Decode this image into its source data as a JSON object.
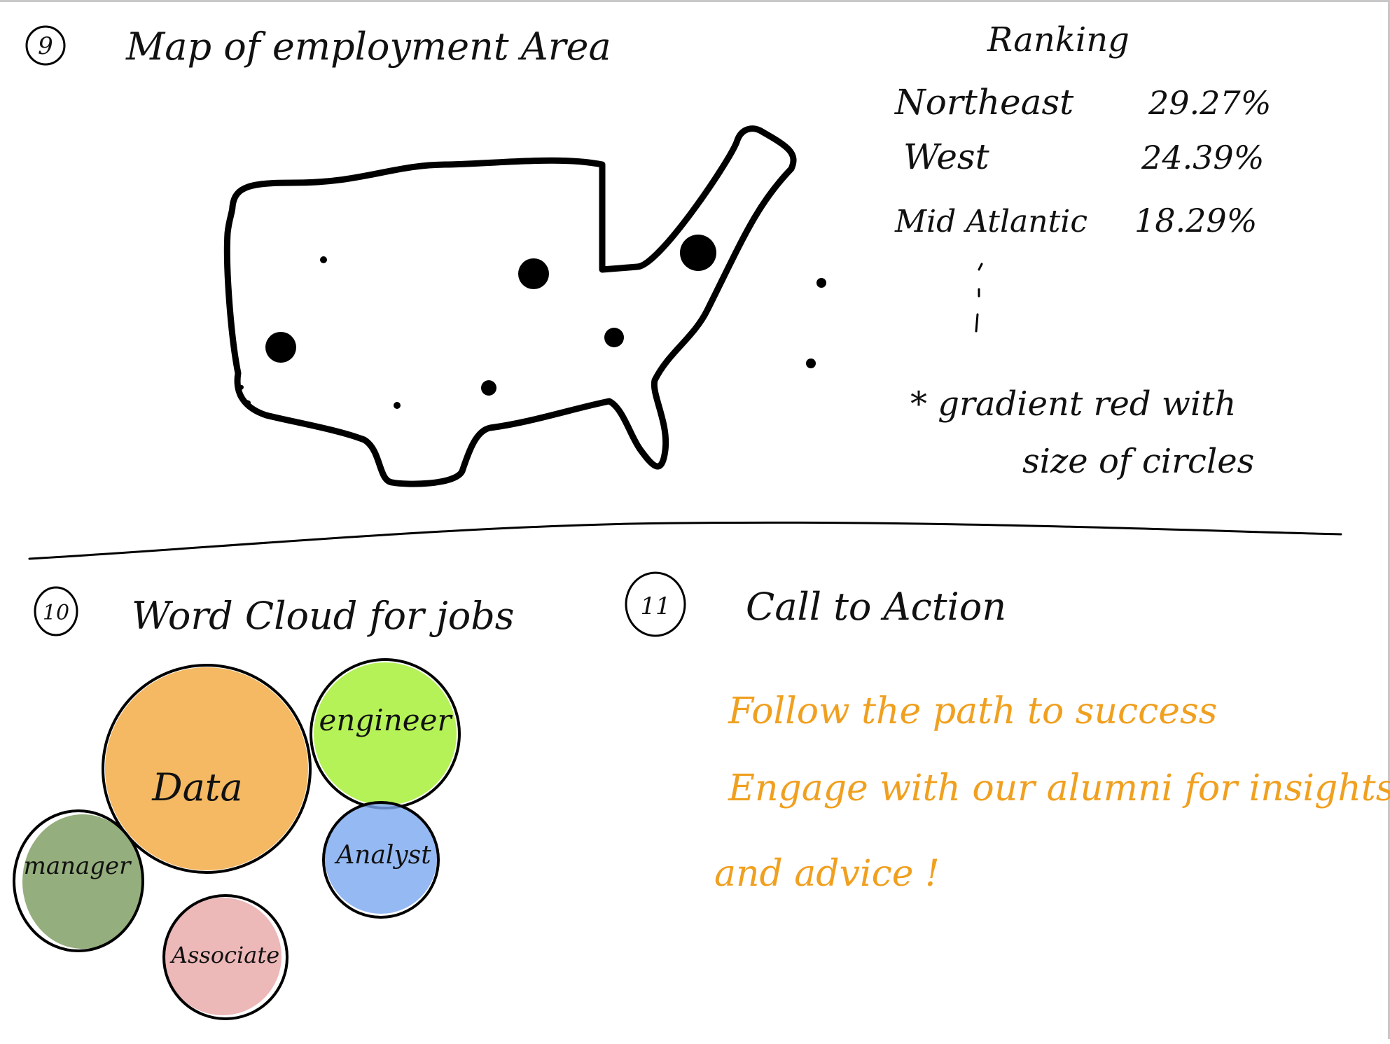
{
  "section9": {
    "number": "9",
    "title": "Map of employment Area",
    "ranking": {
      "heading": "Ranking",
      "rows": [
        {
          "region": "Northeast",
          "percent": "29.27%"
        },
        {
          "region": "West",
          "percent": "24.39%"
        },
        {
          "region": "Mid Atlantic",
          "percent": "18.29%"
        }
      ],
      "note_line1": "* gradient red with",
      "note_line2": "size of circles"
    }
  },
  "section10": {
    "number": "10",
    "title": "Word Cloud for jobs",
    "bubbles": [
      {
        "label": "Data",
        "fill": "#f0a12e"
      },
      {
        "label": "engineer",
        "fill": "#a8f03a"
      },
      {
        "label": "Analyst",
        "fill": "#7aa8f0"
      },
      {
        "label": "manager",
        "fill": "#7a9a5c"
      },
      {
        "label": "Associate",
        "fill": "#e59a9a"
      }
    ]
  },
  "section11": {
    "number": "11",
    "title": "Call to Action",
    "color": "#f0a020",
    "line1": "Follow the path to success",
    "line2": "Engage with our alumni for insights",
    "line3": "and advice !"
  }
}
